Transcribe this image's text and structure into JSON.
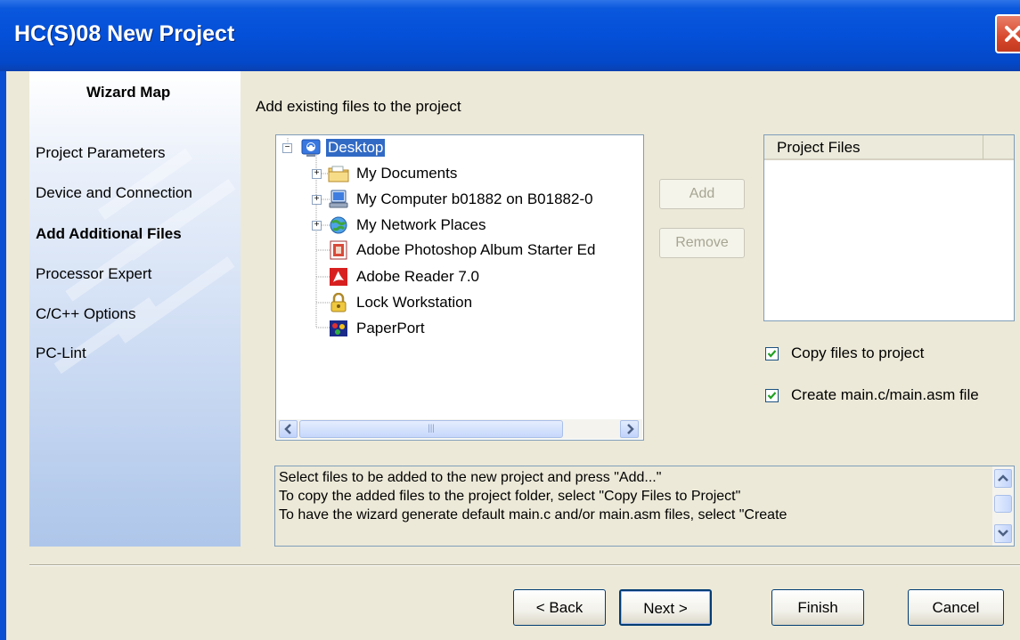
{
  "window": {
    "title": "HC(S)08 New Project",
    "close_icon": "close-icon"
  },
  "wizard_map": {
    "title": "Wizard Map",
    "items": [
      {
        "label": "Project Parameters",
        "active": false
      },
      {
        "label": "Device and Connection",
        "active": false
      },
      {
        "label": "Add Additional Files",
        "active": true
      },
      {
        "label": "Processor Expert",
        "active": false
      },
      {
        "label": "C/C++ Options",
        "active": false
      },
      {
        "label": "PC-Lint",
        "active": false
      }
    ]
  },
  "main": {
    "prompt": "Add existing files to the project",
    "tree": [
      {
        "label": "Desktop",
        "icon": "desktop-icon",
        "selected": true,
        "expander": "minus"
      },
      {
        "label": "My Documents",
        "icon": "folder-icon",
        "expander": "plus"
      },
      {
        "label": "My Computer b01882 on B01882-0",
        "icon": "computer-icon",
        "expander": "plus"
      },
      {
        "label": "My Network Places",
        "icon": "network-icon",
        "expander": "plus"
      },
      {
        "label": "Adobe Photoshop Album Starter Ed",
        "icon": "photoshop-album-icon"
      },
      {
        "label": "Adobe Reader 7.0",
        "icon": "adobe-reader-icon"
      },
      {
        "label": "Lock Workstation",
        "icon": "lock-icon"
      },
      {
        "label": "PaperPort",
        "icon": "paperport-icon"
      }
    ],
    "add_button": "Add",
    "remove_button": "Remove",
    "project_files_header": "Project Files",
    "copy_files_label": "Copy files to project",
    "copy_files_checked": true,
    "create_main_label": "Create main.c/main.asm file",
    "create_main_checked": true,
    "description_lines": [
      "Select files to be added to the new project and press \"Add...\"",
      "To copy the added files to the project folder, select \"Copy Files to Project\"",
      "To have the wizard generate default main.c and/or main.asm files, select \"Create"
    ]
  },
  "footer": {
    "back": "< Back",
    "next": "Next >",
    "finish": "Finish",
    "cancel": "Cancel"
  },
  "colors": {
    "title_bar": "#0450d8",
    "selection": "#316ac5",
    "dialog_bg": "#ece9d8"
  }
}
